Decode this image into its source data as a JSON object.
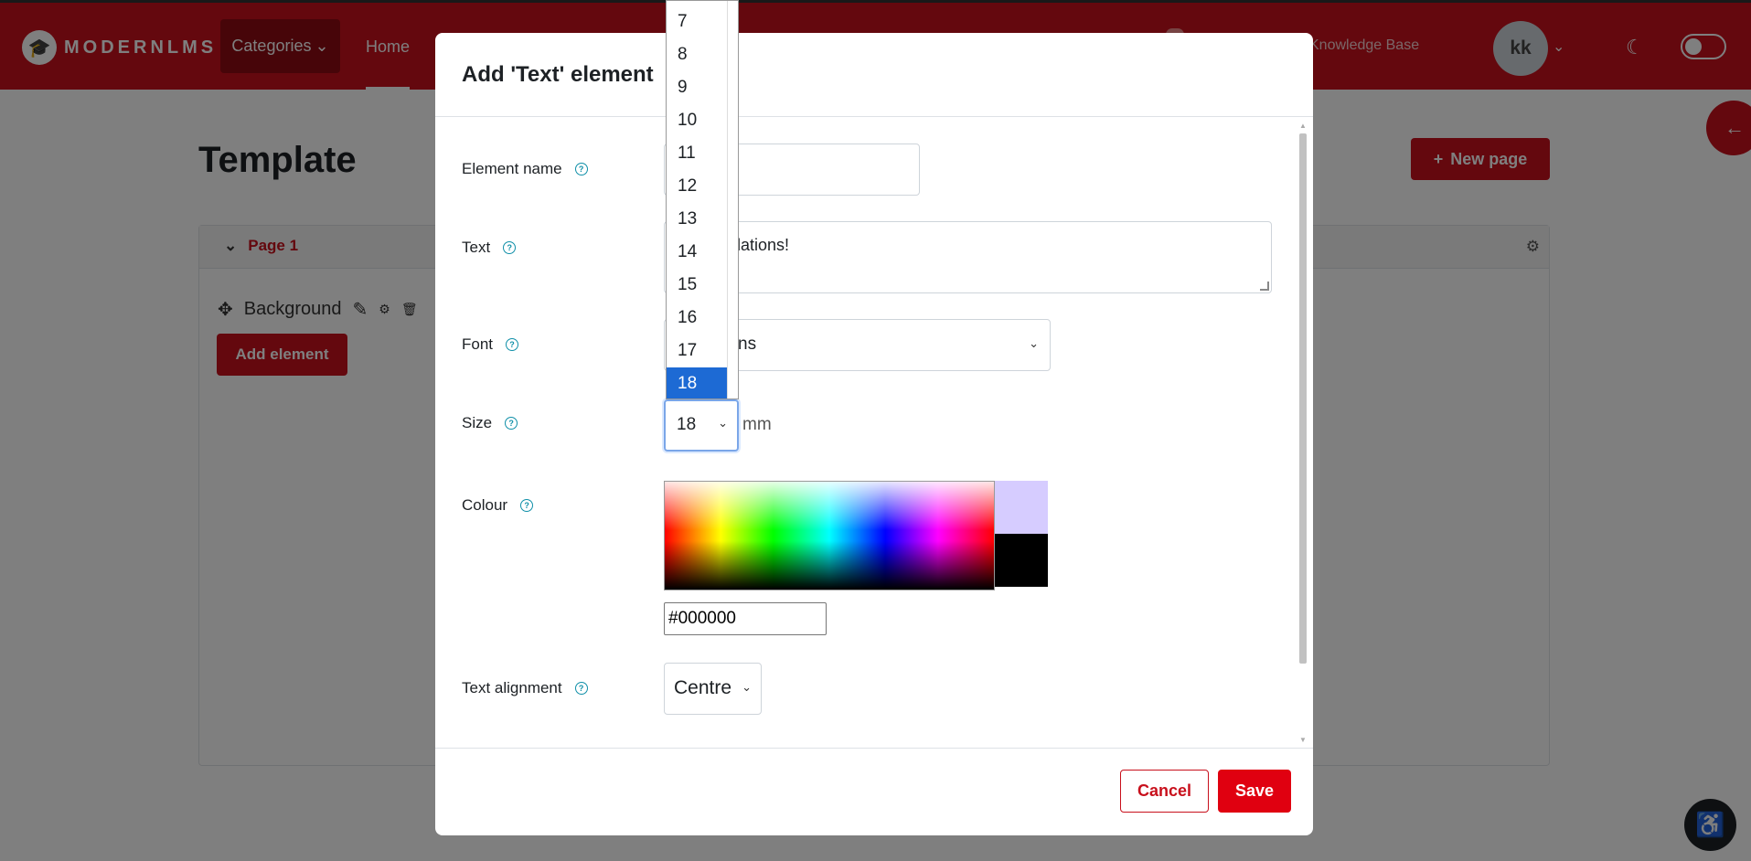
{
  "navbar": {
    "logo_text": "MODERNLMS",
    "categories_label": "Categories",
    "home_label": "Home",
    "kb_label": "Knowledge Base",
    "avatar_initials": "kk"
  },
  "page": {
    "title": "Template",
    "new_page_label": "New page",
    "page_tab_label": "Page 1",
    "element_name": "Background",
    "add_element_label": "Add element"
  },
  "modal": {
    "title": "Add 'Text' element",
    "fields": {
      "element_name_label": "Element name",
      "element_name_value": "",
      "text_label": "Text",
      "text_value_visible": "tulations!",
      "font_label": "Font",
      "font_value_visible": "ns",
      "size_label": "Size",
      "size_value": "18",
      "size_unit": "mm",
      "colour_label": "Colour",
      "colour_value": "#000000",
      "align_label": "Text alignment",
      "align_value": "Centre"
    },
    "cancel_label": "Cancel",
    "save_label": "Save"
  },
  "size_dropdown": {
    "options": [
      "7",
      "8",
      "9",
      "10",
      "11",
      "12",
      "13",
      "14",
      "15",
      "16",
      "17",
      "18"
    ],
    "selected": "18"
  },
  "colors": {
    "brand": "#c8101c",
    "help": "#0f8fa8",
    "selection": "#1d6ad4",
    "swatch_preview": "#d6ccff"
  }
}
